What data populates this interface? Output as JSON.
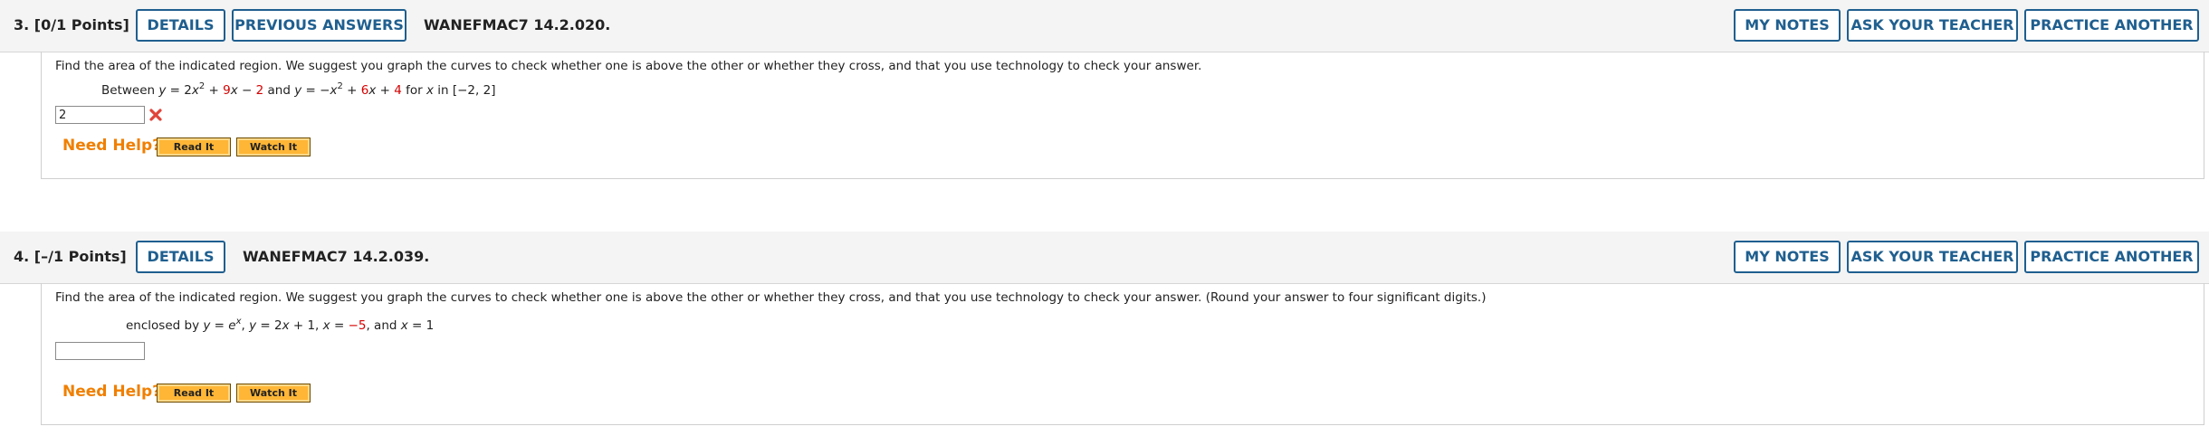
{
  "q3": {
    "number_label": "3.  [0/1 Points]",
    "details_label": "DETAILS",
    "previous_answers_label": "PREVIOUS ANSWERS",
    "code": "WANEFMAC7 14.2.020.",
    "my_notes_label": "MY NOTES",
    "ask_teacher_label": "ASK YOUR TEACHER",
    "practice_another_label": "PRACTICE ANOTHER",
    "prompt": "Find the area of the indicated region. We suggest you graph the curves to check whether one is above the other or whether they cross, and that you use technology to check your answer.",
    "answer_value": "2",
    "answer_status": "incorrect",
    "need_help_label": "Need Help?",
    "read_it_label": "Read It",
    "watch_it_label": "Watch It"
  },
  "q4": {
    "number_label": "4.  [–/1 Points]",
    "details_label": "DETAILS",
    "code": "WANEFMAC7 14.2.039.",
    "my_notes_label": "MY NOTES",
    "ask_teacher_label": "ASK YOUR TEACHER",
    "practice_another_label": "PRACTICE ANOTHER",
    "prompt": "Find the area of the indicated region. We suggest you graph the curves to check whether one is above the other or whether they cross, and that you use technology to check your answer. (Round your answer to four significant digits.)",
    "answer_value": "",
    "need_help_label": "Need Help?",
    "read_it_label": "Read It",
    "watch_it_label": "Watch It"
  },
  "colors": {
    "button_blue": "#1f5f8f",
    "highlight_red": "#d40000",
    "need_help_orange": "#f07f00",
    "help_button_fill": "#ffb636"
  }
}
